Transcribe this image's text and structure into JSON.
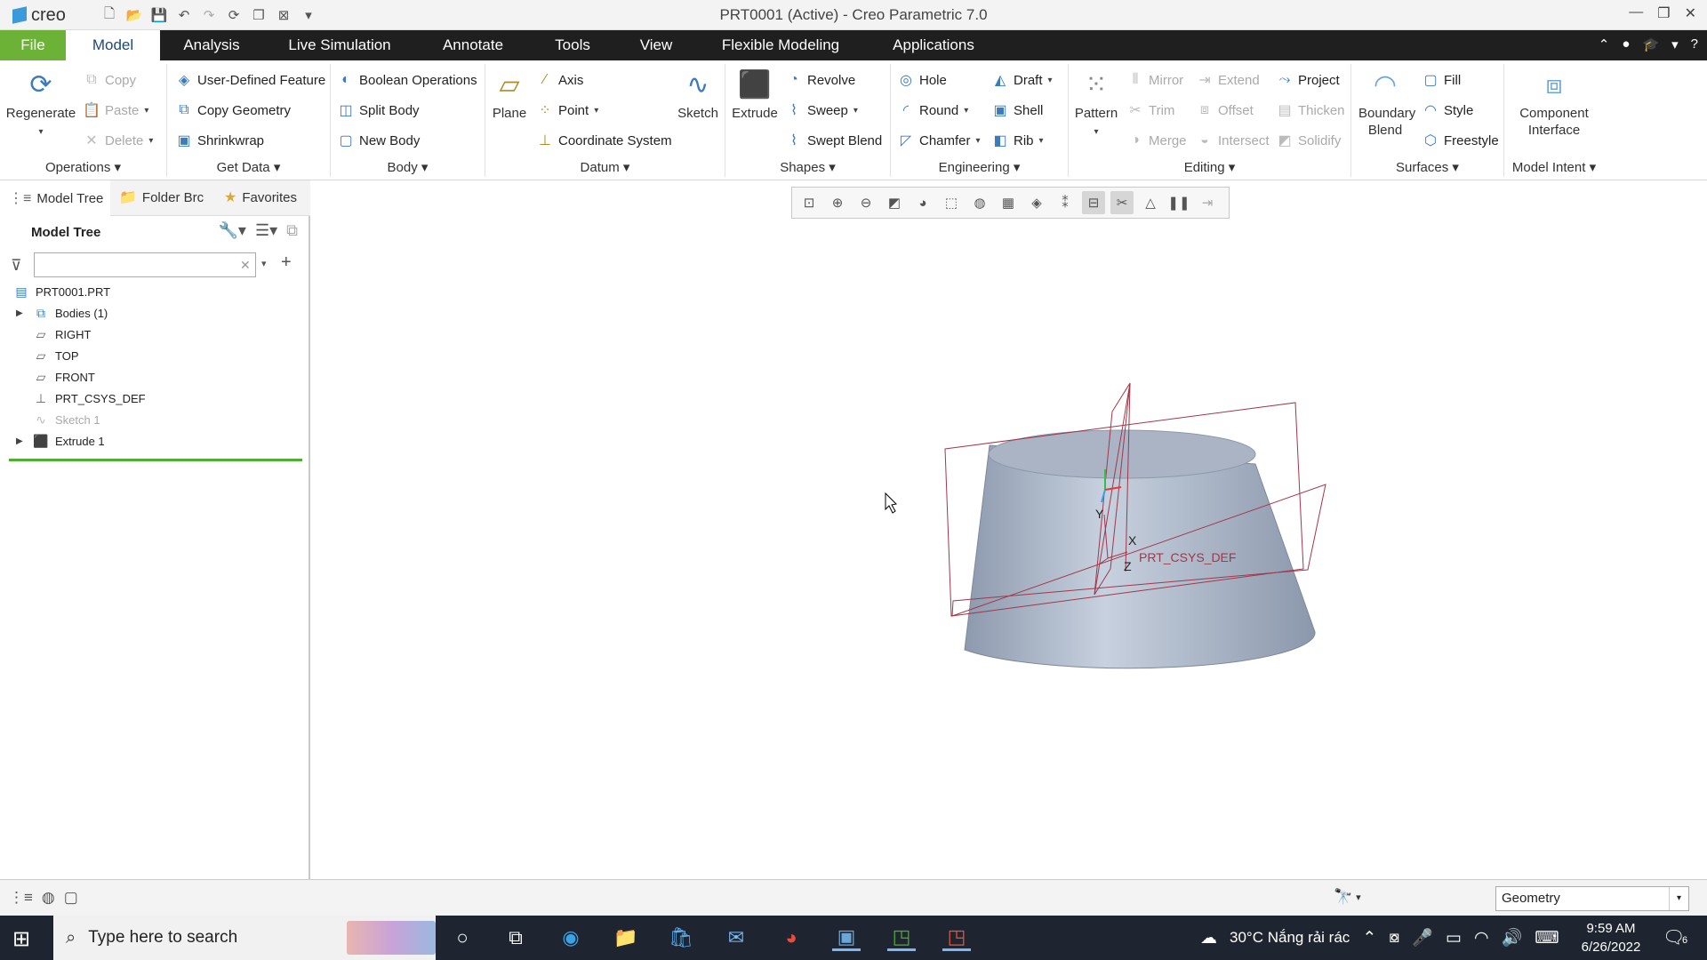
{
  "app": {
    "logo": "creo",
    "title": "PRT0001 (Active) - Creo Parametric 7.0"
  },
  "menu": {
    "tabs": [
      "File",
      "Model",
      "Analysis",
      "Live Simulation",
      "Annotate",
      "Tools",
      "View",
      "Flexible Modeling",
      "Applications"
    ],
    "active": "Model",
    "colors": {
      "file": "#6bb236",
      "bar": "#1f1f1f"
    }
  },
  "ribbon": {
    "operations": {
      "label": "Operations",
      "regenerate": "Regenerate",
      "copy": "Copy",
      "paste": "Paste",
      "delete": "Delete"
    },
    "getdata": {
      "label": "Get Data",
      "udf": "User-Defined Feature",
      "copy_geometry": "Copy Geometry",
      "shrinkwrap": "Shrinkwrap"
    },
    "body": {
      "label": "Body",
      "boolean": "Boolean Operations",
      "split": "Split Body",
      "new": "New Body"
    },
    "datum": {
      "label": "Datum",
      "plane": "Plane",
      "axis": "Axis",
      "point": "Point",
      "csys": "Coordinate System",
      "sketch": "Sketch"
    },
    "shapes": {
      "label": "Shapes",
      "extrude": "Extrude",
      "revolve": "Revolve",
      "sweep": "Sweep",
      "swept_blend": "Swept Blend"
    },
    "engineering": {
      "label": "Engineering",
      "hole": "Hole",
      "round": "Round",
      "chamfer": "Chamfer",
      "draft": "Draft",
      "shell": "Shell",
      "rib": "Rib"
    },
    "editing": {
      "label": "Editing",
      "pattern": "Pattern",
      "mirror": "Mirror",
      "trim": "Trim",
      "merge": "Merge",
      "extend": "Extend",
      "offset": "Offset",
      "intersect": "Intersect",
      "project": "Project",
      "thicken": "Thicken",
      "solidify": "Solidify"
    },
    "surfaces": {
      "label": "Surfaces",
      "boundary_blend": "Boundary Blend",
      "fill": "Fill",
      "style": "Style",
      "freestyle": "Freestyle"
    },
    "model_intent": {
      "label": "Model Intent",
      "component_interface": "Component Interface"
    }
  },
  "panel": {
    "tabs": {
      "model_tree": "Model Tree",
      "folder": "Folder Brc",
      "favorites": "Favorites"
    },
    "title": "Model Tree",
    "search": {
      "value": "",
      "placeholder": ""
    },
    "tree": [
      {
        "label": "PRT0001.PRT",
        "icon": "part-icon"
      },
      {
        "label": "Bodies (1)",
        "icon": "bodies-icon"
      },
      {
        "label": "RIGHT",
        "icon": "datum-plane-icon"
      },
      {
        "label": "TOP",
        "icon": "datum-plane-icon"
      },
      {
        "label": "FRONT",
        "icon": "datum-plane-icon"
      },
      {
        "label": "PRT_CSYS_DEF",
        "icon": "csys-icon"
      },
      {
        "label": "Sketch 1",
        "icon": "sketch-icon"
      },
      {
        "label": "Extrude 1",
        "icon": "extrude-icon"
      }
    ]
  },
  "viewport": {
    "csys_label": "PRT_CSYS_DEF",
    "axes": {
      "x": "X",
      "y": "Y",
      "z": "Z"
    },
    "colors": {
      "body": "#a9b4c6",
      "datum": "#a0384a"
    }
  },
  "status": {
    "filter": "Geometry"
  },
  "taskbar": {
    "search_placeholder": "Type here to search",
    "weather": "30°C  Nắng rải rác",
    "time": "9:59 AM",
    "date": "6/26/2022",
    "notifications": "6"
  }
}
